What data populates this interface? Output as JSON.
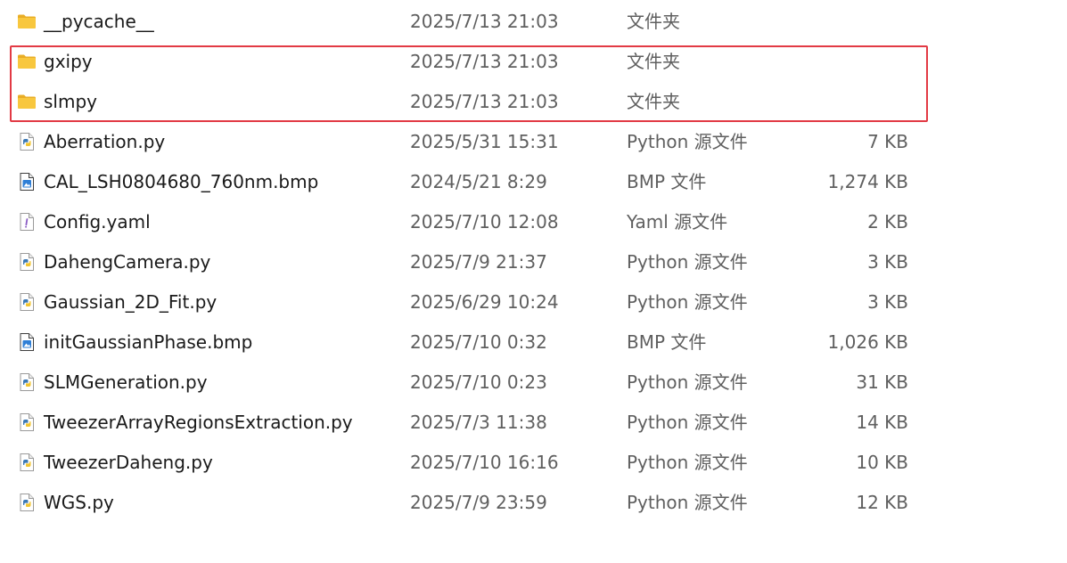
{
  "files": [
    {
      "name": "__pycache__",
      "date": "2025/7/13 21:03",
      "type": "文件夹",
      "size": "",
      "icon": "folder-icon"
    },
    {
      "name": "gxipy",
      "date": "2025/7/13 21:03",
      "type": "文件夹",
      "size": "",
      "icon": "folder-icon"
    },
    {
      "name": "slmpy",
      "date": "2025/7/13 21:03",
      "type": "文件夹",
      "size": "",
      "icon": "folder-icon"
    },
    {
      "name": "Aberration.py",
      "date": "2025/5/31 15:31",
      "type": "Python 源文件",
      "size": "7 KB",
      "icon": "python-file-icon"
    },
    {
      "name": "CAL_LSH0804680_760nm.bmp",
      "date": "2024/5/21 8:29",
      "type": "BMP 文件",
      "size": "1,274 KB",
      "icon": "bmp-file-icon"
    },
    {
      "name": "Config.yaml",
      "date": "2025/7/10 12:08",
      "type": "Yaml 源文件",
      "size": "2 KB",
      "icon": "yaml-file-icon"
    },
    {
      "name": "DahengCamera.py",
      "date": "2025/7/9 21:37",
      "type": "Python 源文件",
      "size": "3 KB",
      "icon": "python-file-icon"
    },
    {
      "name": "Gaussian_2D_Fit.py",
      "date": "2025/6/29 10:24",
      "type": "Python 源文件",
      "size": "3 KB",
      "icon": "python-file-icon"
    },
    {
      "name": "initGaussianPhase.bmp",
      "date": "2025/7/10 0:32",
      "type": "BMP 文件",
      "size": "1,026 KB",
      "icon": "bmp-file-icon"
    },
    {
      "name": "SLMGeneration.py",
      "date": "2025/7/10 0:23",
      "type": "Python 源文件",
      "size": "31 KB",
      "icon": "python-file-icon"
    },
    {
      "name": "TweezerArrayRegionsExtraction.py",
      "date": "2025/7/3 11:38",
      "type": "Python 源文件",
      "size": "14 KB",
      "icon": "python-file-icon"
    },
    {
      "name": "TweezerDaheng.py",
      "date": "2025/7/10 16:16",
      "type": "Python 源文件",
      "size": "10 KB",
      "icon": "python-file-icon"
    },
    {
      "name": "WGS.py",
      "date": "2025/7/9 23:59",
      "type": "Python 源文件",
      "size": "12 KB",
      "icon": "python-file-icon"
    }
  ],
  "colors": {
    "highlight": "#e23a44",
    "folder": "#f8c73e",
    "python_blue": "#3b78b5",
    "python_yellow": "#f2c530",
    "yaml_purple": "#8a5cc4",
    "bmp_blue": "#2f7fd6"
  }
}
